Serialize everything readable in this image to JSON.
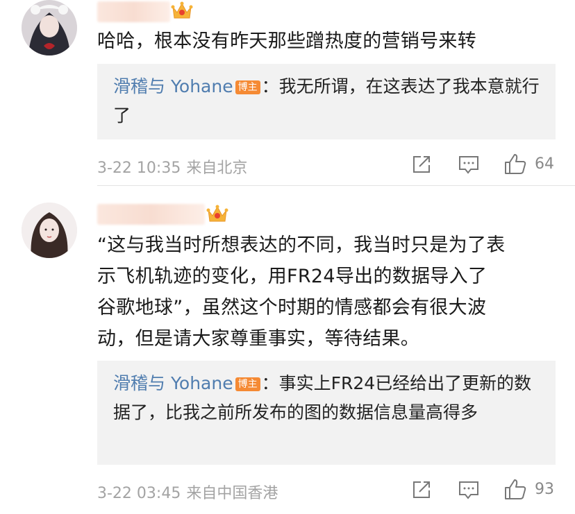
{
  "comments": [
    {
      "text": "哈哈，根本没有昨天那些蹭热度的营销号来转",
      "reply": {
        "author": "滑稽与 Yohane",
        "badge": "博主",
        "separator": "：",
        "text": "我无所谓，在这表达了我本意就行了"
      },
      "time": "3-22 10:35",
      "location": "来自北京",
      "likes": "64"
    },
    {
      "text_lines": [
        "“这与我当时所想表达的不同，我当时只是为了表",
        "示飞机轨迹的变化，用FR24导出的数据导入了",
        "谷歌地球”，虽然这个时期的情感都会有很大波",
        "动，但是请大家尊重事实，等待结果。"
      ],
      "reply": {
        "author": "滑稽与 Yohane",
        "badge": "博主",
        "separator": "：",
        "text": "事实上FR24已经给出了更新的数据了，比我之前所发布的图的数据信息量高得多"
      },
      "time": "3-22 03:45",
      "location": "来自中国香港",
      "likes": "93"
    }
  ],
  "icons": {
    "vip": "crown-icon",
    "share": "share-icon",
    "comment": "comment-icon",
    "like": "like-icon"
  },
  "colors": {
    "author_link": "#507daf",
    "badge_bg": "#f58a34",
    "meta_text": "#a3a3a3",
    "reply_bg": "#f2f2f2"
  }
}
